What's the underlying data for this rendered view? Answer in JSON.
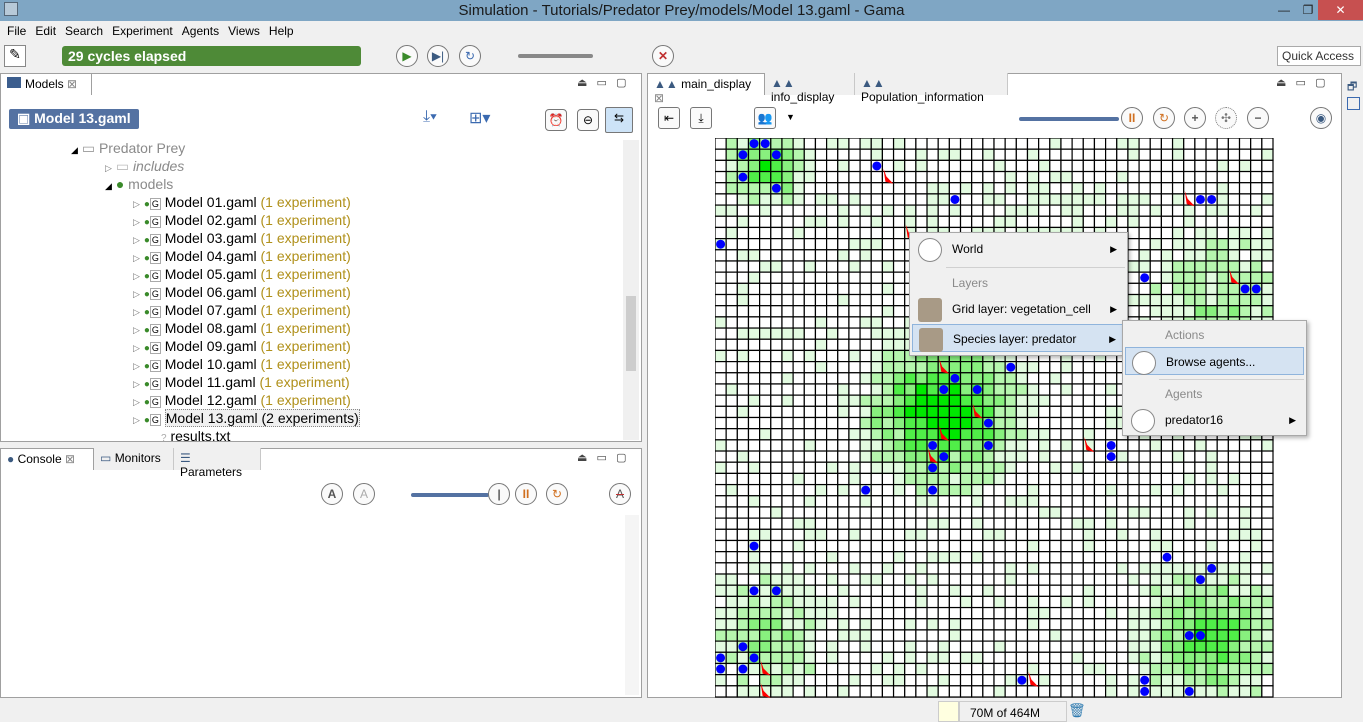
{
  "window": {
    "title": "Simulation - Tutorials/Predator Prey/models/Model 13.gaml - Gama",
    "minimize": "—",
    "restore": "❐",
    "close": "✕"
  },
  "menu": [
    "File",
    "Edit",
    "Search",
    "Experiment",
    "Agents",
    "Views",
    "Help"
  ],
  "toolbar": {
    "cycles": "29 cycles elapsed",
    "quick_access": "Quick Access"
  },
  "models_panel": {
    "tab": "Models",
    "selected_model": "Model 13.gaml",
    "tree": {
      "project": "Predator Prey",
      "folders": [
        "includes",
        "models"
      ],
      "files": [
        {
          "name": "Model 01.gaml",
          "info": "(1 experiment)"
        },
        {
          "name": "Model 02.gaml",
          "info": "(1 experiment)"
        },
        {
          "name": "Model 03.gaml",
          "info": "(1 experiment)"
        },
        {
          "name": "Model 04.gaml",
          "info": "(1 experiment)"
        },
        {
          "name": "Model 05.gaml",
          "info": "(1 experiment)"
        },
        {
          "name": "Model 06.gaml",
          "info": "(1 experiment)"
        },
        {
          "name": "Model 07.gaml",
          "info": "(1 experiment)"
        },
        {
          "name": "Model 08.gaml",
          "info": "(1 experiment)"
        },
        {
          "name": "Model 09.gaml",
          "info": "(1 experiment)"
        },
        {
          "name": "Model 10.gaml",
          "info": "(1 experiment)"
        },
        {
          "name": "Model 11.gaml",
          "info": "(1 experiment)"
        },
        {
          "name": "Model 12.gaml",
          "info": "(1 experiment)"
        },
        {
          "name": "Model 13.gaml",
          "info": "(2 experiments)"
        }
      ],
      "extra_file": "results.txt"
    }
  },
  "bottom_panel": {
    "tabs": [
      "Console",
      "Monitors",
      "Parameters"
    ]
  },
  "display": {
    "tabs": [
      "main_display",
      "info_display",
      "Population_information"
    ],
    "grid_size": [
      50,
      50
    ],
    "colors": {
      "prey": "#0000ff",
      "predator": "#ff0000",
      "veg_high": "#00e800",
      "veg_low": "#e2fbe0"
    },
    "prey_cells": [
      [
        3,
        0
      ],
      [
        4,
        0
      ],
      [
        2,
        1
      ],
      [
        5,
        1
      ],
      [
        2,
        3
      ],
      [
        5,
        4
      ],
      [
        14,
        2
      ],
      [
        21,
        5
      ],
      [
        43,
        5
      ],
      [
        44,
        5
      ],
      [
        0,
        9
      ],
      [
        38,
        12
      ],
      [
        47,
        13
      ],
      [
        48,
        13
      ],
      [
        21,
        21
      ],
      [
        23,
        22
      ],
      [
        26,
        20
      ],
      [
        24,
        25
      ],
      [
        20,
        22
      ],
      [
        24,
        27
      ],
      [
        19,
        27
      ],
      [
        20,
        28
      ],
      [
        19,
        29
      ],
      [
        19,
        31
      ],
      [
        13,
        31
      ],
      [
        35,
        27
      ],
      [
        35,
        28
      ],
      [
        3,
        36
      ],
      [
        40,
        37
      ],
      [
        44,
        38
      ],
      [
        43,
        39
      ],
      [
        3,
        40
      ],
      [
        5,
        40
      ],
      [
        42,
        44
      ],
      [
        43,
        44
      ],
      [
        2,
        45
      ],
      [
        0,
        46
      ],
      [
        3,
        46
      ],
      [
        0,
        47
      ],
      [
        2,
        47
      ],
      [
        38,
        48
      ],
      [
        38,
        49
      ],
      [
        27,
        48
      ],
      [
        42,
        49
      ]
    ],
    "predator_cells": [
      [
        15,
        3
      ],
      [
        17,
        8
      ],
      [
        42,
        5
      ],
      [
        46,
        12
      ],
      [
        20,
        20
      ],
      [
        23,
        24
      ],
      [
        20,
        26
      ],
      [
        19,
        28
      ],
      [
        33,
        27
      ],
      [
        4,
        47
      ],
      [
        4,
        49
      ],
      [
        28,
        48
      ]
    ]
  },
  "context_menu": {
    "items": [
      {
        "label": "World"
      },
      {
        "header": "Layers"
      },
      {
        "label": "Grid layer: vegetation_cell"
      },
      {
        "label": "Species layer: predator"
      }
    ],
    "submenu": {
      "header1": "Actions",
      "action": "Browse agents...",
      "header2": "Agents",
      "agent": "predator16"
    }
  },
  "status": {
    "memory": "70M of 464M"
  }
}
